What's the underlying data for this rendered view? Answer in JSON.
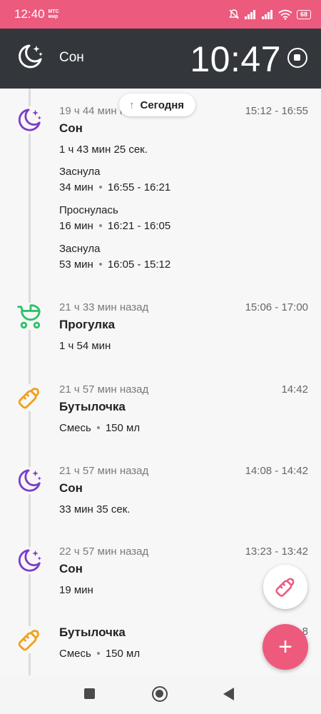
{
  "status_bar": {
    "time": "12:40",
    "operator_line1": "МТС",
    "operator_line2": "мир",
    "battery": "68"
  },
  "header": {
    "title": "Сон",
    "clock": "10:47",
    "icon": "moon-stars-icon"
  },
  "today_pill": {
    "label": "Сегодня"
  },
  "entries": [
    {
      "icon": "moon-stars-icon",
      "ago": "19 ч 44 мин назад",
      "range": "15:12 - 16:55",
      "title": "Сон",
      "lines": [
        "1 ч 43 мин 25 сек.",
        "Заснула",
        "Проснулась",
        "Заснула"
      ],
      "subs": [
        {
          "dur": "34 мин",
          "range": "16:55 - 16:21"
        },
        {
          "dur": "16 мин",
          "range": "16:21 - 16:05"
        },
        {
          "dur": "53 мин",
          "range": "16:05 - 15:12"
        }
      ]
    },
    {
      "icon": "stroller-icon",
      "ago": "21 ч 33 мин назад",
      "range": "15:06 - 17:00",
      "title": "Прогулка",
      "line": "1 ч 54 мин"
    },
    {
      "icon": "bottle-icon",
      "ago": "21 ч 57 мин назад",
      "range": "14:42",
      "title": "Бутылочка",
      "detail_a": "Смесь",
      "detail_b": "150 мл"
    },
    {
      "icon": "moon-stars-icon",
      "ago": "21 ч 57 мин назад",
      "range": "14:08 - 14:42",
      "title": "Сон",
      "line": "33 мин 35 сек."
    },
    {
      "icon": "moon-stars-icon",
      "ago": "22 ч 57 мин назад",
      "range": "13:23 - 13:42",
      "title": "Сон",
      "line": "19 мин"
    },
    {
      "icon": "bottle-icon",
      "range": "…8",
      "title": "Бутылочка",
      "detail_a": "Смесь",
      "detail_b": "150 мл"
    }
  ],
  "fab": {
    "label": "+"
  },
  "colors": {
    "accent": "#ec5a7e",
    "header_bg": "#33373c",
    "sleep": "#7b3fc6",
    "walk": "#2fc06a",
    "bottle": "#f2a01b"
  }
}
